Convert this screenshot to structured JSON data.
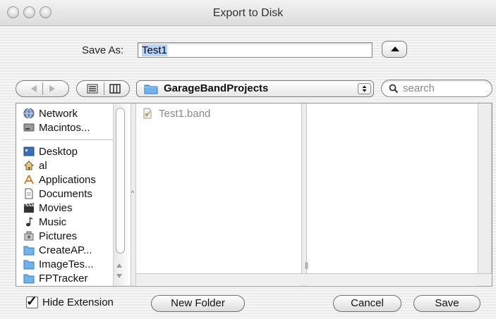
{
  "window": {
    "title": "Export to Disk"
  },
  "save_as": {
    "label": "Save As:",
    "value": "Test1"
  },
  "location": {
    "folder": "GarageBandProjects"
  },
  "search": {
    "placeholder": "search"
  },
  "sidebar": {
    "devices": [
      "Network",
      "Macintos..."
    ],
    "places": [
      "Desktop",
      "al",
      "Applications",
      "Documents",
      "Movies",
      "Music",
      "Pictures",
      "CreateAP...",
      "ImageTes...",
      "FPTracker"
    ]
  },
  "files": [
    "Test1.band"
  ],
  "options": {
    "hide_extension": {
      "label": "Hide Extension",
      "checked": true
    }
  },
  "buttons": {
    "new_folder": "New Folder",
    "cancel": "Cancel",
    "save": "Save"
  },
  "colors": {
    "selection": "#b5d5ff",
    "folder_blue": "#5aa4e6"
  }
}
